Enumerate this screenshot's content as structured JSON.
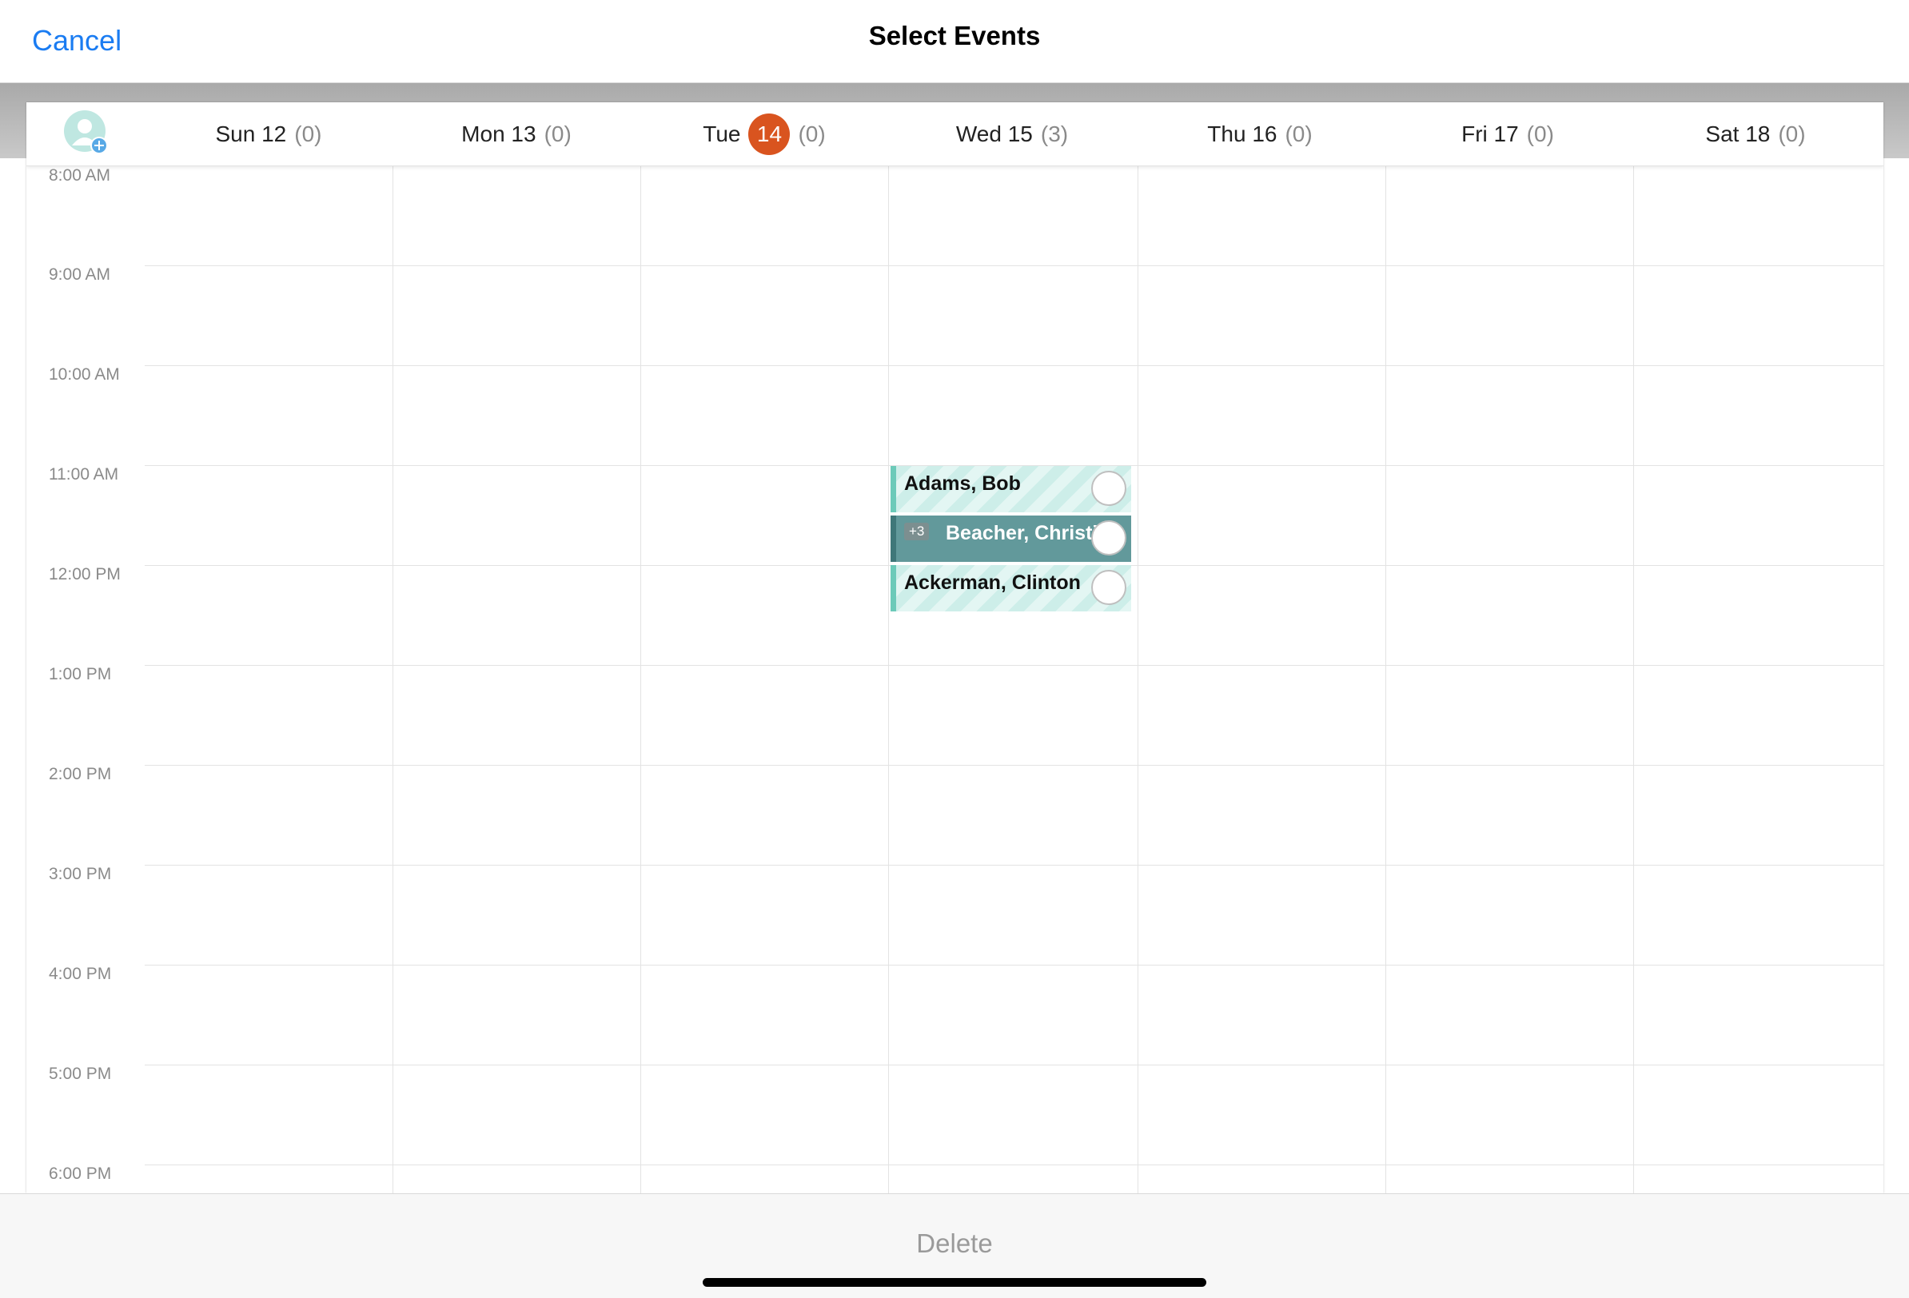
{
  "nav": {
    "cancel_label": "Cancel",
    "title": "Select Events"
  },
  "days": [
    {
      "label": "Sun 12",
      "count": "(0)",
      "today": false
    },
    {
      "label": "Mon 13",
      "count": "(0)",
      "today": false
    },
    {
      "label": "Tue",
      "today_number": "14",
      "count": "(0)",
      "today": true
    },
    {
      "label": "Wed 15",
      "count": "(3)",
      "today": false
    },
    {
      "label": "Thu 16",
      "count": "(0)",
      "today": false
    },
    {
      "label": "Fri 17",
      "count": "(0)",
      "today": false
    },
    {
      "label": "Sat 18",
      "count": "(0)",
      "today": false
    }
  ],
  "times": [
    "8:00 AM",
    "9:00 AM",
    "10:00 AM",
    "11:00 AM",
    "12:00 PM",
    "1:00 PM",
    "2:00 PM",
    "3:00 PM",
    "4:00 PM",
    "5:00 PM",
    "6:00 PM"
  ],
  "events": [
    {
      "name": "Adams, Bob",
      "selected": false
    },
    {
      "name": "Beacher, Christi",
      "badge": "+3",
      "selected": true
    },
    {
      "name": "Ackerman, Clinton",
      "selected": false
    }
  ],
  "footer": {
    "delete_label": "Delete"
  },
  "colors": {
    "accent": "#1a7cf2",
    "today_badge": "#d9541f",
    "event": "#cdeee9",
    "event_selected": "#62999b"
  },
  "icons": {
    "add_contact": "add-user-icon"
  }
}
